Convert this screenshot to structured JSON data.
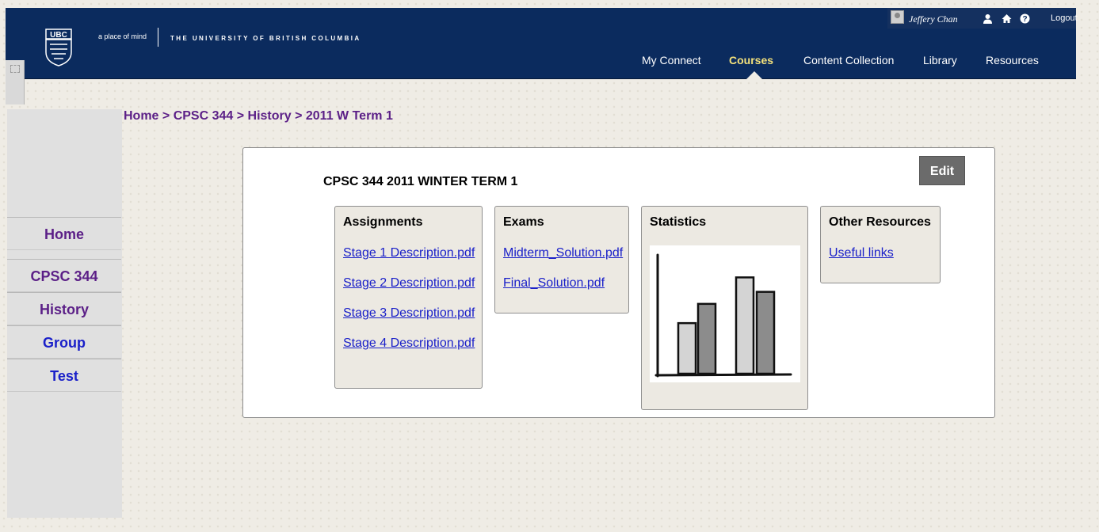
{
  "header": {
    "tagline": "a place of mind",
    "university": "THE UNIVERSITY OF BRITISH COLUMBIA",
    "user_name": "Jeffery Chan",
    "logout": "Logout",
    "logo_text": "UBC",
    "nav": [
      {
        "label": "My Connect"
      },
      {
        "label": "Courses",
        "active": true
      },
      {
        "label": "Content Collection"
      },
      {
        "label": "Library"
      },
      {
        "label": "Resources"
      }
    ]
  },
  "breadcrumb": "Home > CPSC 344 > History > 2011 W Term 1",
  "sidebar": {
    "items": [
      {
        "label": "Home"
      },
      {
        "label": "CPSC 344"
      },
      {
        "label": "History"
      },
      {
        "label": "Group"
      },
      {
        "label": "Test"
      }
    ]
  },
  "panel": {
    "title": "CPSC 344 2011 WINTER TERM 1",
    "edit_label": "Edit",
    "assignments": {
      "title": "Assignments",
      "links": [
        "Stage 1 Description.pdf",
        "Stage 2 Description.pdf",
        "Stage 3 Description.pdf",
        "Stage 4 Description.pdf"
      ]
    },
    "exams": {
      "title": "Exams",
      "links": [
        "Midterm_Solution.pdf",
        "Final_Solution.pdf"
      ]
    },
    "statistics": {
      "title": "Statistics",
      "bars": [
        {
          "value": 0.42,
          "shade": "#d4d4d4"
        },
        {
          "value": 0.58,
          "shade": "#8c8c8c"
        },
        {
          "value": 0.8,
          "shade": "#d4d4d4"
        },
        {
          "value": 0.68,
          "shade": "#8c8c8c"
        }
      ]
    },
    "other": {
      "title": "Other Resources",
      "links": [
        "Useful links"
      ]
    }
  },
  "colors": {
    "header_bg": "#0b2b5e",
    "nav_active": "#f5e27b",
    "visited_link": "#5b1f87",
    "link": "#1a20c9",
    "edit_bg": "#6b6b6b"
  }
}
